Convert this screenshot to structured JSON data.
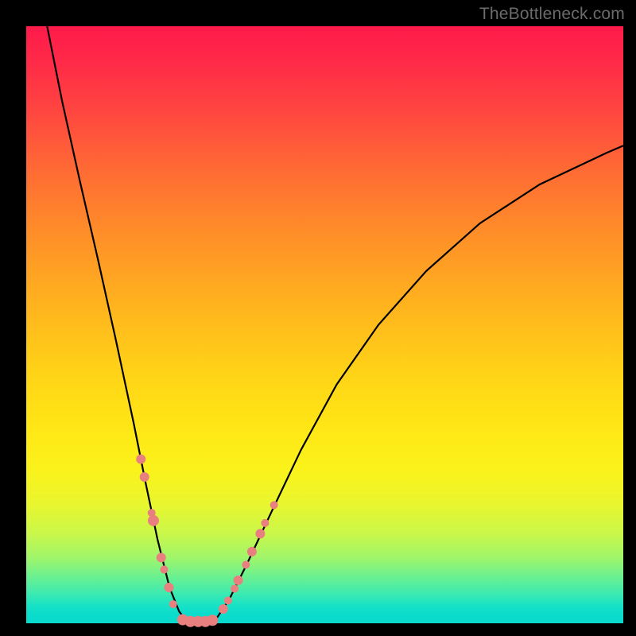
{
  "watermark": "TheBottleneck.com",
  "chart_data": {
    "type": "line",
    "title": "",
    "xlabel": "",
    "ylabel": "",
    "xlim": [
      0,
      1
    ],
    "ylim": [
      0,
      1
    ],
    "background_gradient": {
      "direction": "top-to-bottom",
      "stops": [
        {
          "pos": 0.0,
          "color": "#ff1a4a"
        },
        {
          "pos": 0.35,
          "color": "#ff8f28"
        },
        {
          "pos": 0.67,
          "color": "#ffe615"
        },
        {
          "pos": 0.85,
          "color": "#c9f74a"
        },
        {
          "pos": 1.0,
          "color": "#08dacd"
        }
      ]
    },
    "series": [
      {
        "name": "curve-left",
        "x": [
          0.035,
          0.06,
          0.09,
          0.12,
          0.15,
          0.18,
          0.2,
          0.22,
          0.24,
          0.256,
          0.266,
          0.273
        ],
        "y": [
          1.0,
          0.875,
          0.74,
          0.61,
          0.475,
          0.335,
          0.235,
          0.14,
          0.06,
          0.02,
          0.007,
          0.003
        ]
      },
      {
        "name": "curve-right",
        "x": [
          0.31,
          0.32,
          0.34,
          0.37,
          0.41,
          0.46,
          0.52,
          0.59,
          0.67,
          0.76,
          0.86,
          0.97,
          1.0
        ],
        "y": [
          0.003,
          0.01,
          0.04,
          0.1,
          0.185,
          0.29,
          0.4,
          0.5,
          0.59,
          0.67,
          0.735,
          0.787,
          0.8
        ]
      }
    ],
    "scatter": [
      {
        "name": "dots-left",
        "x": [
          0.192,
          0.198,
          0.21,
          0.213,
          0.226,
          0.231,
          0.239,
          0.246
        ],
        "y": [
          0.275,
          0.245,
          0.185,
          0.172,
          0.11,
          0.09,
          0.06,
          0.032
        ],
        "r": [
          6,
          6,
          5,
          7,
          6,
          5,
          6,
          5
        ]
      },
      {
        "name": "dots-bottom",
        "x": [
          0.262,
          0.275,
          0.288,
          0.3,
          0.312
        ],
        "y": [
          0.006,
          0.003,
          0.003,
          0.003,
          0.005
        ],
        "r": [
          7,
          7,
          7,
          7,
          7
        ]
      },
      {
        "name": "dots-right",
        "x": [
          0.33,
          0.338,
          0.349,
          0.355,
          0.368,
          0.378,
          0.392,
          0.4,
          0.415
        ],
        "y": [
          0.024,
          0.038,
          0.058,
          0.072,
          0.098,
          0.12,
          0.15,
          0.168,
          0.198
        ],
        "r": [
          6,
          5,
          5,
          6,
          5,
          6,
          6,
          5,
          5
        ]
      }
    ]
  }
}
